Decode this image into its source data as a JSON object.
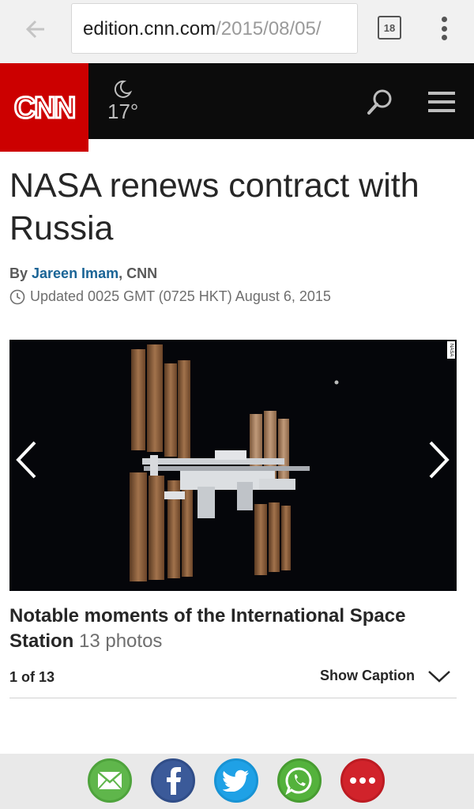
{
  "browser": {
    "url_domain": "edition.cnn.com",
    "url_path": "/2015/08/05/",
    "tab_count": "18"
  },
  "header": {
    "logo_text": "CNN",
    "weather_icon": "moon-icon",
    "temperature": "17°",
    "search_icon": "search-icon",
    "menu_icon": "hamburger-menu-icon",
    "brand_color": "#cc0000"
  },
  "article": {
    "headline": "NASA renews contract with Russia",
    "byline_prefix": "By ",
    "author": "Jareen Imam",
    "byline_suffix": ", CNN",
    "updated": "Updated 0025 GMT (0725 HKT) August 6, 2015"
  },
  "gallery": {
    "credit": "NASA",
    "title": "Notable moments of the International Space Station",
    "photo_count": "13 photos",
    "counter": "1 of 13",
    "show_caption": "Show Caption"
  },
  "share": {
    "items": [
      {
        "name": "email",
        "icon": "envelope-icon",
        "color": "#5fb64b"
      },
      {
        "name": "facebook",
        "icon": "facebook-icon",
        "color": "#3b5a99"
      },
      {
        "name": "twitter",
        "icon": "twitter-bird-icon",
        "color": "#1fa1e6"
      },
      {
        "name": "whatsapp",
        "icon": "whatsapp-icon",
        "color": "#54b23c"
      },
      {
        "name": "more",
        "icon": "more-dots-icon",
        "color": "#d1232b"
      }
    ]
  }
}
